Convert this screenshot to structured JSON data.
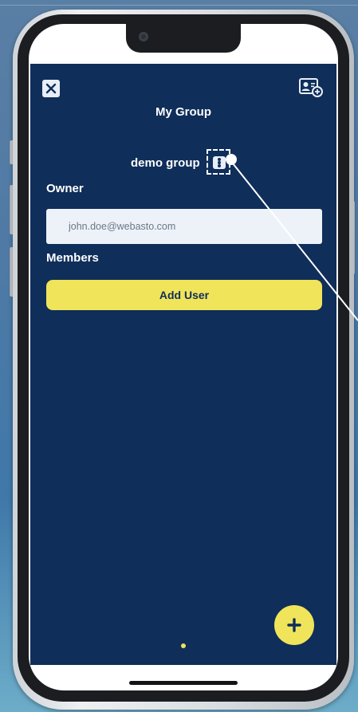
{
  "header": {
    "title": "My Group",
    "close_icon": "close-icon",
    "add_user_icon": "user-card-add-icon"
  },
  "group": {
    "name": "demo group",
    "menu_icon": "more-vertical-icon"
  },
  "owner": {
    "label": "Owner",
    "email": "john.doe@webasto.com"
  },
  "members": {
    "label": "Members",
    "add_user_label": "Add User"
  },
  "fab": {
    "icon": "plus-icon"
  },
  "colors": {
    "app_background": "#0f2e5a",
    "accent_yellow": "#f0e45a",
    "field_background": "#edf2f9"
  }
}
